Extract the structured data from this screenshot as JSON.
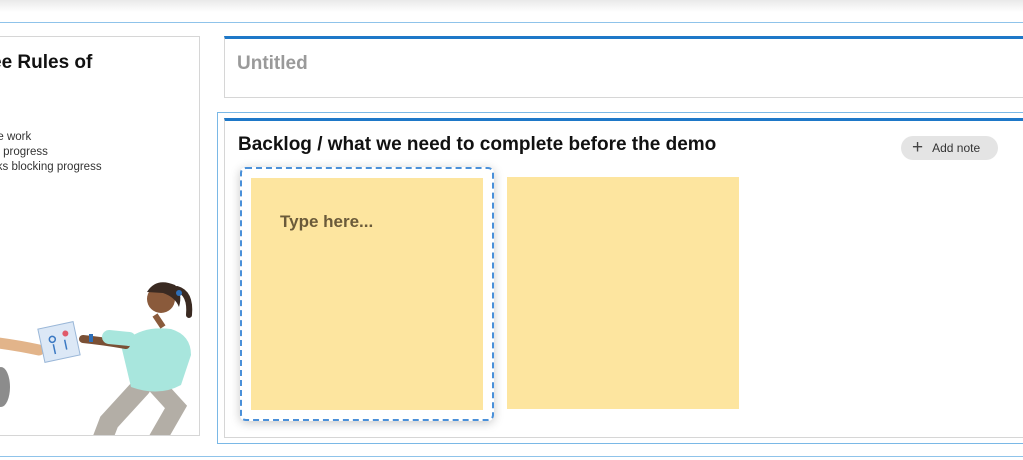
{
  "rules_card": {
    "title": "ee Rules of",
    "lines": [
      "he work",
      " in progress",
      "sks blocking progress"
    ]
  },
  "untitled_card": {
    "title": "Untitled"
  },
  "backlog": {
    "title": "Backlog / what we need to complete before the demo",
    "add_note_label": "Add note",
    "notes": [
      {
        "text": "Type here..."
      },
      {
        "text": ""
      }
    ]
  },
  "colors": {
    "accent": "#1e78c8",
    "note_yellow": "#fde59f",
    "selection_dash": "#4a90d9"
  },
  "icons": [
    "plus-icon"
  ]
}
